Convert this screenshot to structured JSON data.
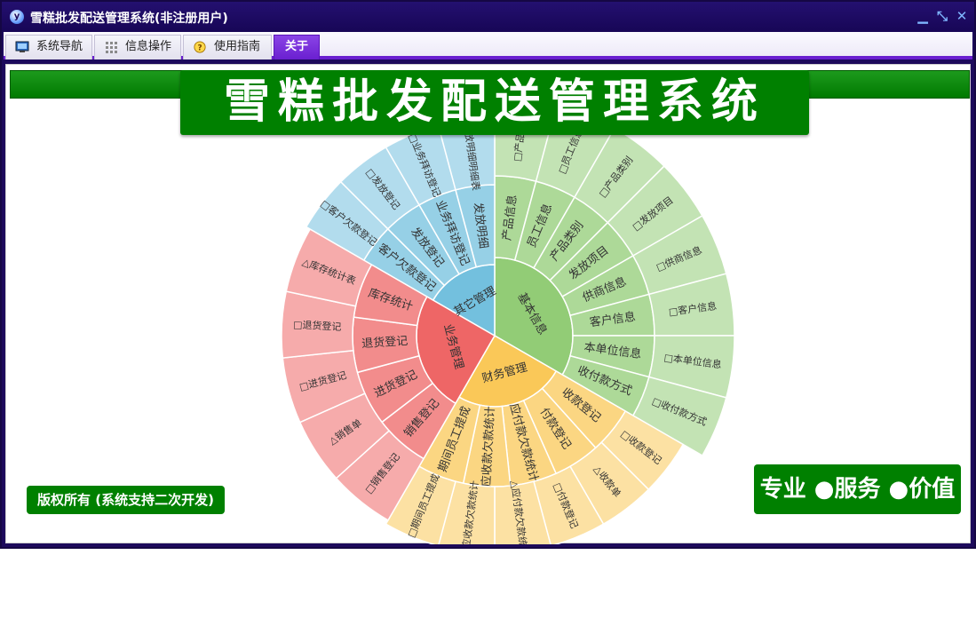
{
  "window": {
    "title": "雪糕批发配送管理系统(非注册用户)",
    "app_icon_glyph": "y",
    "controls": {
      "minimize": "▁",
      "restore": "⤡",
      "close": "✕"
    }
  },
  "menu": {
    "tabs": [
      {
        "label": "系统导航",
        "icon": "monitor-icon",
        "active": false
      },
      {
        "label": "信息操作",
        "icon": "grid-icon",
        "active": false
      },
      {
        "label": "使用指南",
        "icon": "help-icon",
        "active": false
      },
      {
        "label": "关于",
        "icon": "",
        "active": true
      }
    ]
  },
  "content": {
    "main_title": "雪糕批发配送管理系统",
    "copyright": "版权所有 (系统支持二次开发)",
    "slogan": "专业 ●服务 ●价值"
  },
  "chart_data": {
    "type": "sunburst",
    "title": "",
    "groups": [
      {
        "name": "基本信息",
        "color": "#92cc76",
        "children": [
          "产品信息",
          "员工信息",
          "产品类别",
          "发放项目",
          "供商信息",
          "客户信息",
          "本单位信息",
          "收付款方式"
        ],
        "leaves": [
          "□产品信息",
          "□员工信息",
          "□产品类别",
          "□发放项目",
          "□供商信息",
          "□客户信息",
          "□本单位信息",
          "□收付款方式"
        ]
      },
      {
        "name": "财务管理",
        "color": "#fac858",
        "children": [
          "收款登记",
          "付款登记",
          "应付款欠款统计",
          "应收款欠款统计",
          "期间员工提成"
        ],
        "leaves": [
          "□收款登记",
          "△收款单",
          "□付款登记",
          "△应付款欠款统计",
          "△应收款欠款统计",
          "□期间员工提成"
        ]
      },
      {
        "name": "业务管理",
        "color": "#ee6666",
        "children": [
          "销售登记",
          "进货登记",
          "退货登记",
          "库存统计"
        ],
        "leaves": [
          "□销售登记",
          "△销售单",
          "□进货登记",
          "□退货登记",
          "△库存统计表"
        ]
      },
      {
        "name": "其它管理",
        "color": "#73c0de",
        "children": [
          "客户欠款登记",
          "发放登记",
          "业务拜访登记",
          "发放明细"
        ],
        "leaves": [
          "□客户欠款登记",
          "□发放登记",
          "□业务拜访登记",
          "△发放明细明细表"
        ]
      }
    ]
  }
}
